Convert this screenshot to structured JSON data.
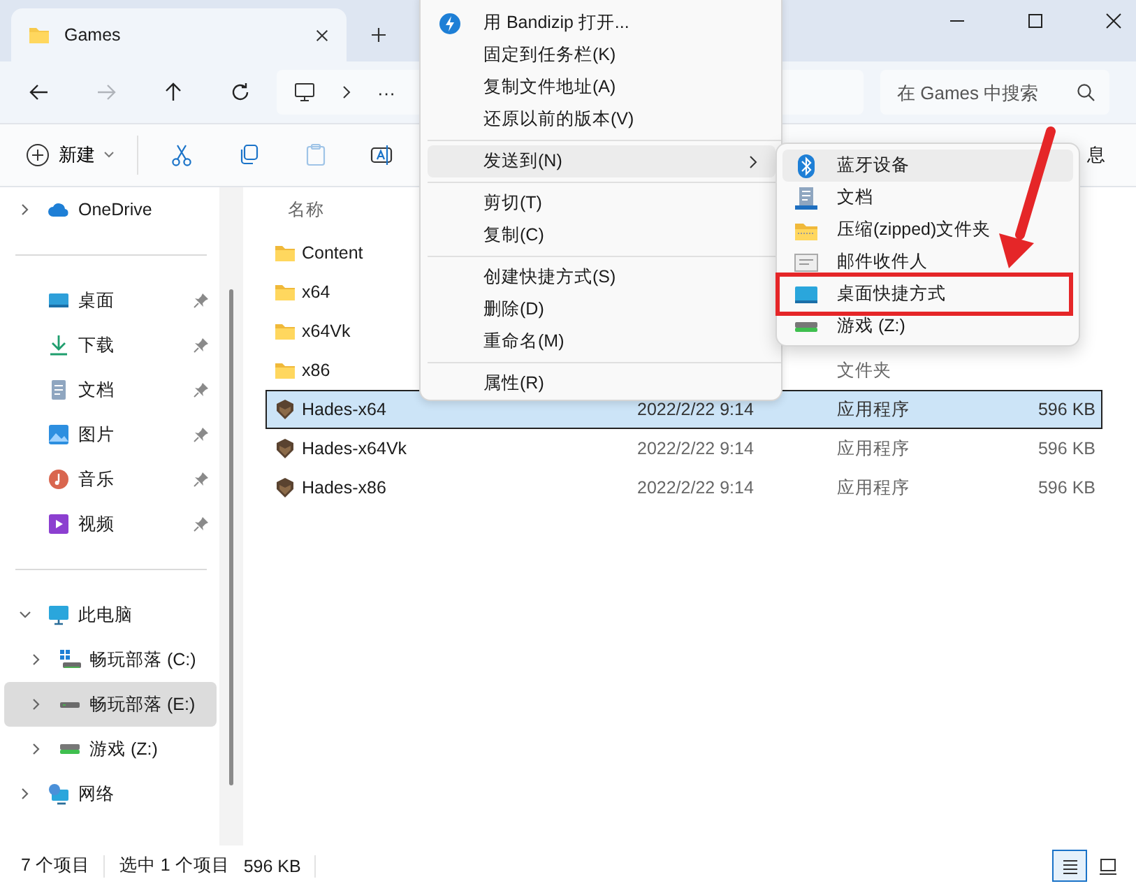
{
  "window": {
    "title": "Games"
  },
  "navigation": {
    "buttons": [
      {
        "kind": "back",
        "disabled": false
      },
      {
        "kind": "forward",
        "disabled": true
      },
      {
        "kind": "up",
        "disabled": false
      },
      {
        "kind": "refresh",
        "disabled": false
      }
    ],
    "address_more": "···",
    "search": {
      "placeholder": "在 Games 中搜索"
    }
  },
  "toolbar": {
    "new_button": "新建",
    "actions": [
      {
        "kind": "cut",
        "disabled": false
      },
      {
        "kind": "copy",
        "disabled": false
      },
      {
        "kind": "paste",
        "disabled": true
      },
      {
        "kind": "rename",
        "disabled": false
      }
    ],
    "details_button": "息"
  },
  "sidebar": {
    "sections": [
      {
        "items": [
          {
            "label": "OneDrive",
            "kind": "cloud",
            "pinned": false,
            "expanded": false,
            "selected": false
          }
        ]
      },
      {
        "items": [
          {
            "label": "桌面",
            "kind": "desktop",
            "pinned": true,
            "selected": false
          },
          {
            "label": "下载",
            "kind": "download",
            "pinned": true,
            "selected": false
          },
          {
            "label": "文档",
            "kind": "documents",
            "pinned": true,
            "selected": false
          },
          {
            "label": "图片",
            "kind": "pictures",
            "pinned": true,
            "selected": false
          },
          {
            "label": "音乐",
            "kind": "music",
            "pinned": true,
            "selected": false
          },
          {
            "label": "视频",
            "kind": "videos",
            "pinned": true,
            "selected": false
          }
        ]
      },
      {
        "items": [
          {
            "label": "此电脑",
            "kind": "computer",
            "pinned": false,
            "expanded": true,
            "selected": false,
            "children": [
              {
                "label": "畅玩部落 (C:)",
                "kind": "system-drive",
                "pinned": false,
                "expanded": false,
                "selected": false
              },
              {
                "label": "畅玩部落 (E:)",
                "kind": "drive",
                "pinned": false,
                "expanded": false,
                "selected": true
              },
              {
                "label": "游戏 (Z:)",
                "kind": "green-drive",
                "pinned": false,
                "expanded": false,
                "selected": false
              }
            ]
          },
          {
            "label": "网络",
            "kind": "network",
            "pinned": false,
            "expanded": false,
            "selected": false
          }
        ]
      }
    ]
  },
  "files": {
    "name_header": "名称",
    "rows": [
      {
        "name": "Content",
        "kind": "folder",
        "selected": false
      },
      {
        "name": "x64",
        "kind": "folder",
        "selected": false
      },
      {
        "name": "x64Vk",
        "kind": "folder",
        "selected": false
      },
      {
        "name": "x86",
        "kind": "folder",
        "type": "文件夹",
        "selected": false
      },
      {
        "name": "Hades-x64",
        "kind": "app",
        "date": "2022/2/22 9:14",
        "type": "应用程序",
        "size": "596 KB",
        "selected": true
      },
      {
        "name": "Hades-x64Vk",
        "kind": "app",
        "date": "2022/2/22 9:14",
        "type": "应用程序",
        "size": "596 KB",
        "selected": false
      },
      {
        "name": "Hades-x86",
        "kind": "app",
        "date": "2022/2/22 9:14",
        "type": "应用程序",
        "size": "596 KB",
        "selected": false
      }
    ]
  },
  "context_menu": {
    "groups": [
      {
        "items": [
          {
            "label": "用 Bandizip 打开...",
            "kind": "bandizip",
            "submenu": false,
            "highlighted": false
          },
          {
            "label": "固定到任务栏(K)",
            "kind": "plain",
            "submenu": false,
            "highlighted": false
          },
          {
            "label": "复制文件地址(A)",
            "kind": "plain",
            "submenu": false,
            "highlighted": false
          },
          {
            "label": "还原以前的版本(V)",
            "kind": "plain",
            "submenu": false,
            "highlighted": false
          }
        ]
      },
      {
        "items": [
          {
            "label": "发送到(N)",
            "kind": "plain",
            "submenu": true,
            "highlighted": true
          }
        ]
      },
      {
        "items": [
          {
            "label": "剪切(T)",
            "kind": "plain",
            "submenu": false,
            "highlighted": false
          },
          {
            "label": "复制(C)",
            "kind": "plain",
            "submenu": false,
            "highlighted": false
          }
        ]
      },
      {
        "items": [
          {
            "label": "创建快捷方式(S)",
            "kind": "plain",
            "submenu": false,
            "highlighted": false
          },
          {
            "label": "删除(D)",
            "kind": "plain",
            "submenu": false,
            "highlighted": false
          },
          {
            "label": "重命名(M)",
            "kind": "plain",
            "submenu": false,
            "highlighted": false
          }
        ]
      },
      {
        "items": [
          {
            "label": "属性(R)",
            "kind": "plain",
            "submenu": false,
            "highlighted": false
          }
        ]
      }
    ]
  },
  "submenu": {
    "items": [
      {
        "label": "蓝牙设备",
        "kind": "bluetooth",
        "highlighted": true,
        "outlined": false
      },
      {
        "label": "文档",
        "kind": "documents",
        "highlighted": false,
        "outlined": false
      },
      {
        "label": "压缩(zipped)文件夹",
        "kind": "zip",
        "highlighted": false,
        "outlined": false
      },
      {
        "label": "邮件收件人",
        "kind": "mail",
        "highlighted": false,
        "outlined": false
      },
      {
        "label": "桌面快捷方式",
        "kind": "desktop",
        "highlighted": false,
        "outlined": true
      },
      {
        "label": "游戏 (Z:)",
        "kind": "green-drive",
        "highlighted": false,
        "outlined": false
      }
    ]
  },
  "status_bar": {
    "item_count": "7 个项目",
    "selection": "选中 1 个项目",
    "selection_size": "596 KB",
    "views": [
      {
        "kind": "details",
        "selected": true
      },
      {
        "kind": "tiles",
        "selected": false
      }
    ]
  }
}
